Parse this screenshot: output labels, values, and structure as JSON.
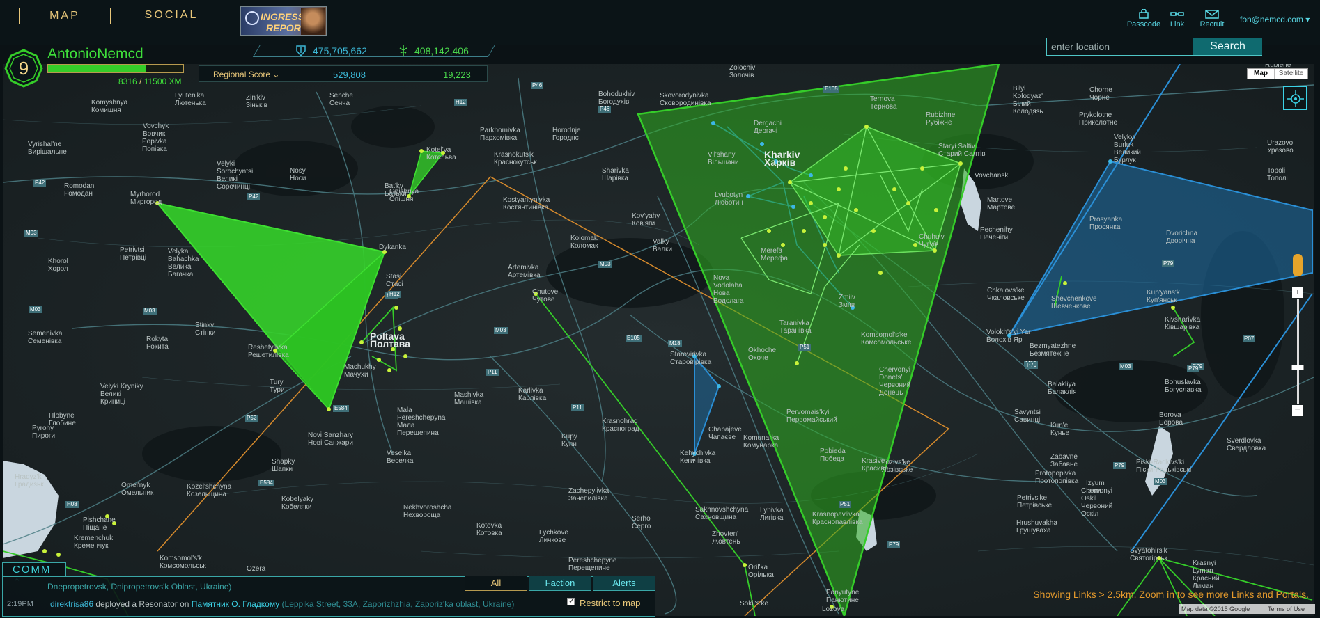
{
  "nav": {
    "map_tab": "MAP",
    "social_tab": "SOCIAL",
    "banner_line1": "INGRESS",
    "banner_line2": "REPORT"
  },
  "header": {
    "passcode": "Passcode",
    "link": "Link",
    "recruit": "Recruit",
    "user_email": "fon@nemcd.com",
    "search_placeholder": "enter location",
    "search_button": "Search"
  },
  "player": {
    "level": "9",
    "name": "AntonioNemcd",
    "xp_current": "8316",
    "xp_max": "11500 XM",
    "xp_fraction": 0.72
  },
  "scores": {
    "global_enlightened": "475,705,662",
    "global_resistance": "408,142,406",
    "regional_label": "Regional Score",
    "regional_enlightened": "529,808",
    "regional_resistance": "19,223"
  },
  "map": {
    "type_map": "Map",
    "type_satellite": "Satellite",
    "links_note": "Showing Links > 2.5km. Zoom in to see more Links and Portals.",
    "credit_data": "Map data ©2015 Google",
    "credit_terms": "Terms of Use",
    "towns": [
      {
        "name": "Zolochiv\nЗолочів"
      },
      {
        "name": "Bohodukhiv\nБогодухів"
      },
      {
        "name": "Skovorodynivka\nСковородинівка"
      },
      {
        "name": "Dergachi\nДергачі"
      },
      {
        "name": "Kharkiv\nХарків"
      },
      {
        "name": "Lyubotyn\nЛюботин"
      },
      {
        "name": "Vil'shany\nВільшани"
      },
      {
        "name": "Merefa\nМерефа"
      },
      {
        "name": "Zmiiv\nЗміїв"
      },
      {
        "name": "Chuhuiv\nЧугуїв"
      },
      {
        "name": "Staryi Saltiv\nСтарий Салтів"
      },
      {
        "name": "Ternova\nТернова"
      },
      {
        "name": "Rubizhne\nРубіжне"
      },
      {
        "name": "Vovchansk"
      },
      {
        "name": "Bilyi\nKolodyaz'\nБілий\nКолодязь"
      },
      {
        "name": "Chorne\nЧорне"
      },
      {
        "name": "Prykolotne\nПриколотне"
      },
      {
        "name": "Velykyi\nBurluk\nВеликий\nБурлук"
      },
      {
        "name": "Urazovo\nУразово"
      },
      {
        "name": "Topoli\nТополі"
      },
      {
        "name": "Rublene"
      },
      {
        "name": "Martove\nМартове"
      },
      {
        "name": "Pechenihy\nПеченіги"
      },
      {
        "name": "Prosyanka\nПросянка"
      },
      {
        "name": "Dvorichna\nДворічна"
      },
      {
        "name": "Chkalovs'ke\nЧкаловське"
      },
      {
        "name": "Shevchenkove\nШевченкове"
      },
      {
        "name": "Kup'yans'k\nКуп'янськ"
      },
      {
        "name": "Kivsharivka\nКівшарівка"
      },
      {
        "name": "Volokh's'yi Yar\nВолохів Яр"
      },
      {
        "name": "Bezmyatezhne\nБезмятежне"
      },
      {
        "name": "Balakliya\nБалаклія"
      },
      {
        "name": "Bohuslavka\nБогуславка"
      },
      {
        "name": "Savyntsi\nСавинці"
      },
      {
        "name": "Kun'e\nКунье"
      },
      {
        "name": "Borova\nБорова"
      },
      {
        "name": "Sverdlovka\nСвердловка"
      },
      {
        "name": "Zabavne\nЗабавне"
      },
      {
        "name": "Piski-Radkivs'ki\nПіски-Радьківські"
      },
      {
        "name": "Izyum\nІзюм"
      },
      {
        "name": "Chervonyi\nOskil\nЧервоний\nОскіл"
      },
      {
        "name": "Protopopivka\nПротопопівка"
      },
      {
        "name": "Petrivs'ke\nПетрівське"
      },
      {
        "name": "Hrushuvakha\nГрушуваха"
      },
      {
        "name": "Svyatohirs'k\nСвятогірськ"
      },
      {
        "name": "Krasnyi\nLyman\nКрасний\nЛиман"
      },
      {
        "name": "Komsomol's'ke\nКомсомольське"
      },
      {
        "name": "Chervonyi\nDonets'\nЧервоний\nДонець"
      },
      {
        "name": "Lozivs'ke\nЛозівське"
      },
      {
        "name": "Krasive\nКрасиве"
      },
      {
        "name": "Pobieda\nПобеда"
      },
      {
        "name": "Pervomais'kyi\nПервомайський"
      },
      {
        "name": "Krasnopavlivka\nКраснопавлівка"
      },
      {
        "name": "Panyutyne\nПанютине"
      },
      {
        "name": "Lozova"
      },
      {
        "name": "Taranivka\nТаранівка"
      },
      {
        "name": "Okhoche\nОхоче"
      },
      {
        "name": "Nova\nVodolaha\nНова\nВодолага"
      },
      {
        "name": "Komunarka\nКомунарка"
      },
      {
        "name": "Chapajeve\nЧапаєве"
      },
      {
        "name": "Starovirivka\nСтаровірівка"
      },
      {
        "name": "Kehychivka\nКегичівка"
      },
      {
        "name": "Krasnohrad\nКрасноград"
      },
      {
        "name": "Kupy\nКупи"
      },
      {
        "name": "Zachepylivka\nЗачепилівка"
      },
      {
        "name": "Sakhnovshchyna\nСахновщина"
      },
      {
        "name": "Lyhivka\nЛигівка"
      },
      {
        "name": "Zhovten'\nЖовтень"
      },
      {
        "name": "Oril'ka\nОрілька"
      },
      {
        "name": "Sokil's'ke"
      },
      {
        "name": "Serho\nСерго"
      },
      {
        "name": "Lychkove\nЛичкове"
      },
      {
        "name": "Pereshchepyne\nПерещепине"
      },
      {
        "name": "Kotovka\nКотовка"
      },
      {
        "name": "Nekhvoroshcha\nНехворощa"
      },
      {
        "name": "Karlivka\nКарлівка"
      },
      {
        "name": "Mashivka\nМашівка"
      },
      {
        "name": "Mala\nPereshchepyna\nМала\nПерещепина"
      },
      {
        "name": "Veselka\nВеселка"
      },
      {
        "name": "Valky\nВалки"
      },
      {
        "name": "Kolomak\nКоломак"
      },
      {
        "name": "Kov'yahy\nКов'яги"
      },
      {
        "name": "Artemivka\nАртемівка"
      },
      {
        "name": "Chutove\nЧутове"
      },
      {
        "name": "Sharivka\nШарівка"
      },
      {
        "name": "Krasnokuts'k\nКраснокутськ"
      },
      {
        "name": "Kostyantynivka\nКостянтинівка"
      },
      {
        "name": "Parkhomivka\nПархомівка"
      },
      {
        "name": "Horodnje\nГороднє"
      },
      {
        "name": "Kotel'va\nКотельва"
      },
      {
        "name": "Opishnya\nОпішня"
      },
      {
        "name": "Bat'ky\nБатьки"
      },
      {
        "name": "Dykanka"
      },
      {
        "name": "Stasi\nСтасі"
      },
      {
        "name": "Poltava\nПолтава"
      },
      {
        "name": "Machukhy\nМачухи"
      },
      {
        "name": "Reshetylivka\nРешетилівка"
      },
      {
        "name": "Tury\nТури"
      },
      {
        "name": "Novi Sanzhary\nНові Санжари"
      },
      {
        "name": "Shapky\nШапки"
      },
      {
        "name": "Kobelyaky\nКобеляки"
      },
      {
        "name": "Kozel'shchyna\nКозельщина"
      },
      {
        "name": "Omel'nyk\nОмельник"
      },
      {
        "name": "Ozera"
      },
      {
        "name": "Kremenchuk\nКременчук"
      },
      {
        "name": "Komsomol's'k\nКомсомольськ"
      },
      {
        "name": "Pishchane\nПіщане"
      },
      {
        "name": "Hradyz'k\nГрадизьк"
      },
      {
        "name": "Hlobyne\nГлобине"
      },
      {
        "name": "Pyrohy\nПироги"
      },
      {
        "name": "Velyki Kryniky\nВеликі\nКриниці"
      },
      {
        "name": "Semenivka\nСеменівка"
      },
      {
        "name": "Rokyta\nРокита"
      },
      {
        "name": "Stinky\nСтінки"
      },
      {
        "name": "Khorol\nХорол"
      },
      {
        "name": "Velyka\nBahachka\nВелика\nБагачка"
      },
      {
        "name": "Petrivtsi\nПетрівці"
      },
      {
        "name": "Myrhorod\nМиргород"
      },
      {
        "name": "Romodan\nРомодан"
      },
      {
        "name": "Velyki\nSorochyntsi\nВеликі\nСорочинці"
      },
      {
        "name": "Nosy\nНоси"
      },
      {
        "name": "Popivka\nПопівка"
      },
      {
        "name": "Vovchyk\nВовчик"
      },
      {
        "name": "Vyrishal'ne\nВирішальне"
      },
      {
        "name": "Komyshnya\nКомишня"
      },
      {
        "name": "Lyuten'ka\nЛютенька"
      },
      {
        "name": "Zin'kiv\nЗіньків"
      },
      {
        "name": "Senche\nСенча"
      }
    ],
    "roads": [
      "P46",
      "H12",
      "E105",
      "P46",
      "P42",
      "M03",
      "M03",
      "P42",
      "H12",
      "M03",
      "M03",
      "P11",
      "H12",
      "M03",
      "M18",
      "E105",
      "P51",
      "P11",
      "P52",
      "E584",
      "E584",
      "H08",
      "P79",
      "P51",
      "M03",
      "P79",
      "P07",
      "P79",
      "P79",
      "M03",
      "P79",
      "P79",
      "M03"
    ]
  },
  "comm": {
    "tab_label": "COMM",
    "prev_line": "Dnepropetrovsk, Dnipropetrovs'k Oblast, Ukraine)",
    "time": "2:19PM",
    "agent": "direktrisa86",
    "verb": " deployed a Resonator on ",
    "portal": "Памятник О. Гладкому",
    "address": " (Leppika Street, 33A, Zaporizhzhia, Zaporiz'ka oblast, Ukraine)",
    "tab_all": "All",
    "tab_faction": "Faction",
    "tab_alerts": "Alerts",
    "restrict_label": "Restrict to map"
  },
  "colors": {
    "enlightened": "#35cc29",
    "resistance": "#2a8fd6",
    "ui_gold": "#e8c77a",
    "ui_cyan": "#3ed0d6"
  }
}
